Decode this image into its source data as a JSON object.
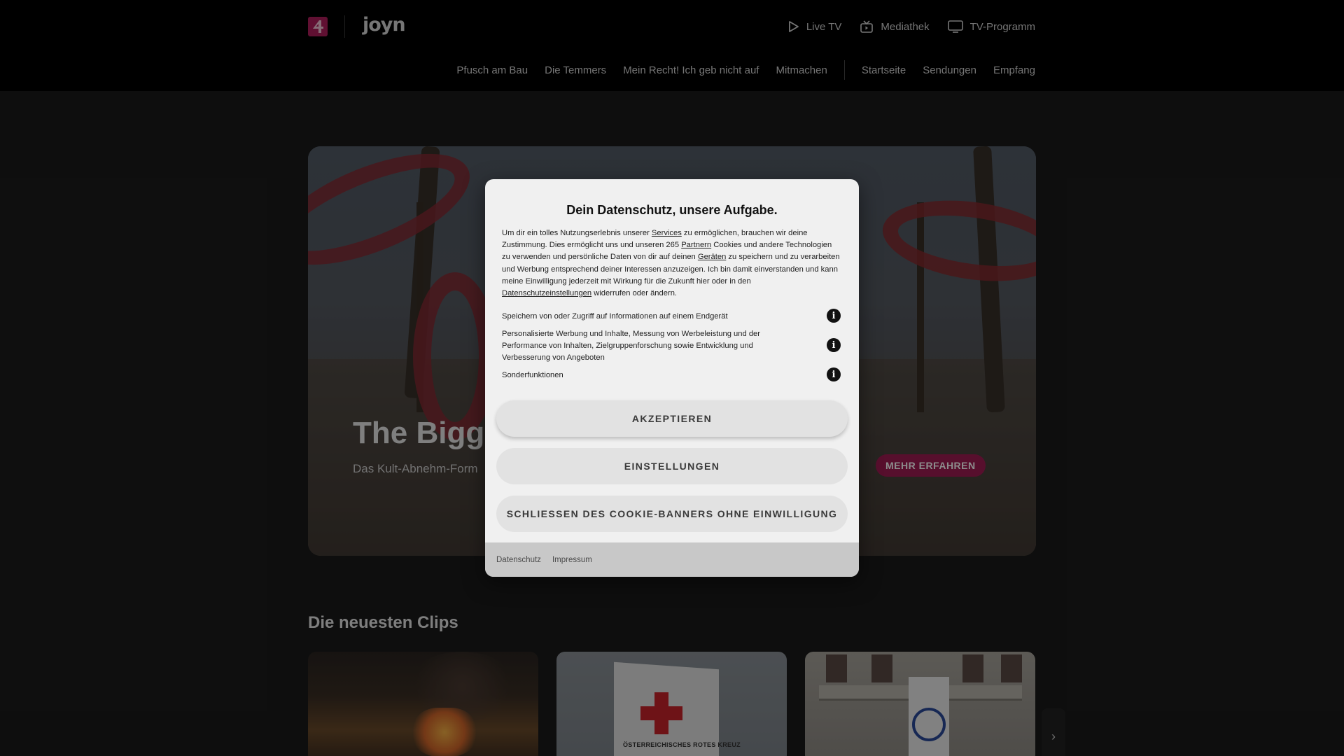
{
  "header": {
    "brand": "joyn",
    "channel_logo_icon": "puls4-logo-icon",
    "top_nav": [
      {
        "label": "Live TV",
        "icon": "play-icon"
      },
      {
        "label": "Mediathek",
        "icon": "mediathek-icon"
      },
      {
        "label": "TV-Programm",
        "icon": "tv-icon"
      }
    ],
    "sub_nav_left": [
      "Pfusch am Bau",
      "Die Temmers",
      "Mein Recht! Ich geb nicht auf",
      "Mitmachen"
    ],
    "sub_nav_right": [
      "Startseite",
      "Sendungen",
      "Empfang"
    ]
  },
  "hero": {
    "title": "The Bigg",
    "subtitle": "Das Kult-Abnehm-Form",
    "cta_label": "MEHR ERFAHREN",
    "cta_color": "#9e1c52"
  },
  "clips": {
    "title": "Die neuesten Clips",
    "clip2_sign_text": "ÖSTERREICHISCHES ROTES KREUZ",
    "next_icon": "chevron-right-icon"
  },
  "consent": {
    "title": "Dein Datenschutz, unsere Aufgabe.",
    "body_parts": [
      "Um dir ein tolles Nutzungserlebnis unserer ",
      "Services",
      " zu ermöglichen, brauchen wir deine Zustimmung. Dies ermöglicht uns und unseren 265 ",
      "Partnern",
      " Cookies und andere Technologien zu verwenden und persönliche Daten von dir auf deinen ",
      "Geräten",
      " zu speichern und zu verarbeiten und Werbung entsprechend deiner Interessen anzuzeigen. Ich bin damit einverstanden und kann meine Einwilligung jederzeit mit Wirkung für die Zukunft hier oder in den ",
      "Datenschutzeinstellungen",
      " widerrufen oder ändern."
    ],
    "purposes": [
      "Speichern von oder Zugriff auf Informationen auf einem Endgerät",
      "Personalisierte Werbung und Inhalte, Messung von Werbeleistung und der Performance von Inhalten, Zielgruppenforschung sowie Entwicklung und Verbesserung von Angeboten",
      "Sonderfunktionen"
    ],
    "info_glyph": "i",
    "accept_label": "AKZEPTIEREN",
    "settings_label": "EINSTELLUNGEN",
    "close_label": "SCHLIESSEN DES COOKIE-BANNERS OHNE EINWILLIGUNG",
    "footer_links": [
      "Datenschutz",
      "Impressum"
    ]
  }
}
